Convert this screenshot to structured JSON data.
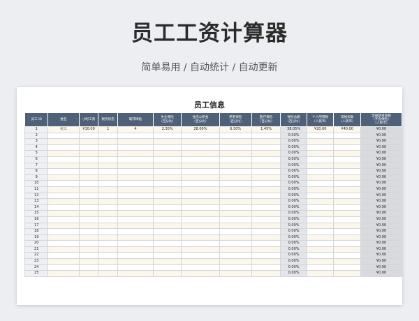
{
  "page": {
    "title": "员工工资计算器",
    "subtitle": "简单易用 / 自动统计 / 自动更新"
  },
  "sheet": {
    "title": "员工信息",
    "headers": [
      "员工 ID",
      "姓名",
      "小时工资",
      "税务状态",
      "联邦津贴",
      "失业保险\n（百分比）",
      "住房公积金\n（百分比）",
      "养老保险\n（百分比）",
      "医疗保险\n（百分比）",
      "保险总额\n（百分比）",
      "个人所得税\n（人民币）",
      "常规扣款\n（人民币）",
      "常规薪资总额\n（不含保险）\n（人民币）"
    ],
    "rows": [
      [
        "1",
        "张三",
        "¥10.00",
        "1",
        "4",
        "2.30%",
        "28.00%",
        "6.30%",
        "1.45%",
        "38.05%",
        "¥20.00",
        "¥40.00",
        "¥0.00"
      ],
      [
        "2",
        "",
        "",
        "",
        "",
        "",
        "",
        "",
        "",
        "0.00%",
        "",
        "",
        "¥0.00"
      ],
      [
        "3",
        "",
        "",
        "",
        "",
        "",
        "",
        "",
        "",
        "0.00%",
        "",
        "",
        "¥0.00"
      ],
      [
        "4",
        "",
        "",
        "",
        "",
        "",
        "",
        "",
        "",
        "0.00%",
        "",
        "",
        "¥0.00"
      ],
      [
        "5",
        "",
        "",
        "",
        "",
        "",
        "",
        "",
        "",
        "0.00%",
        "",
        "",
        "¥0.00"
      ],
      [
        "6",
        "",
        "",
        "",
        "",
        "",
        "",
        "",
        "",
        "0.00%",
        "",
        "",
        "¥0.00"
      ],
      [
        "7",
        "",
        "",
        "",
        "",
        "",
        "",
        "",
        "",
        "0.00%",
        "",
        "",
        "¥0.00"
      ],
      [
        "8",
        "",
        "",
        "",
        "",
        "",
        "",
        "",
        "",
        "0.00%",
        "",
        "",
        "¥0.00"
      ],
      [
        "9",
        "",
        "",
        "",
        "",
        "",
        "",
        "",
        "",
        "0.00%",
        "",
        "",
        "¥0.00"
      ],
      [
        "10",
        "",
        "",
        "",
        "",
        "",
        "",
        "",
        "",
        "0.00%",
        "",
        "",
        "¥0.00"
      ],
      [
        "11",
        "",
        "",
        "",
        "",
        "",
        "",
        "",
        "",
        "0.00%",
        "",
        "",
        "¥0.00"
      ],
      [
        "12",
        "",
        "",
        "",
        "",
        "",
        "",
        "",
        "",
        "0.00%",
        "",
        "",
        "¥0.00"
      ],
      [
        "13",
        "",
        "",
        "",
        "",
        "",
        "",
        "",
        "",
        "0.00%",
        "",
        "",
        "¥0.00"
      ],
      [
        "14",
        "",
        "",
        "",
        "",
        "",
        "",
        "",
        "",
        "0.00%",
        "",
        "",
        "¥0.00"
      ],
      [
        "15",
        "",
        "",
        "",
        "",
        "",
        "",
        "",
        "",
        "0.00%",
        "",
        "",
        "¥0.00"
      ],
      [
        "16",
        "",
        "",
        "",
        "",
        "",
        "",
        "",
        "",
        "0.00%",
        "",
        "",
        "¥0.00"
      ],
      [
        "17",
        "",
        "",
        "",
        "",
        "",
        "",
        "",
        "",
        "0.00%",
        "",
        "",
        "¥0.00"
      ],
      [
        "18",
        "",
        "",
        "",
        "",
        "",
        "",
        "",
        "",
        "0.00%",
        "",
        "",
        "¥0.00"
      ],
      [
        "19",
        "",
        "",
        "",
        "",
        "",
        "",
        "",
        "",
        "0.00%",
        "",
        "",
        "¥0.00"
      ],
      [
        "20",
        "",
        "",
        "",
        "",
        "",
        "",
        "",
        "",
        "0.00%",
        "",
        "",
        "¥0.00"
      ],
      [
        "21",
        "",
        "",
        "",
        "",
        "",
        "",
        "",
        "",
        "0.00%",
        "",
        "",
        "¥0.00"
      ],
      [
        "22",
        "",
        "",
        "",
        "",
        "",
        "",
        "",
        "",
        "0.00%",
        "",
        "",
        "¥0.00"
      ],
      [
        "23",
        "",
        "",
        "",
        "",
        "",
        "",
        "",
        "",
        "0.00%",
        "",
        "",
        "¥0.00"
      ],
      [
        "24",
        "",
        "",
        "",
        "",
        "",
        "",
        "",
        "",
        "0.00%",
        "",
        "",
        "¥0.00"
      ],
      [
        "25",
        "",
        "",
        "",
        "",
        "",
        "",
        "",
        "",
        "0.00%",
        "",
        "",
        "¥0.00"
      ]
    ]
  },
  "colors": {
    "header_bg": "#4f6178",
    "header_text": "#ffffff",
    "row_tint": "#fbf7ec",
    "calc_cell": "#e3e5e8"
  }
}
